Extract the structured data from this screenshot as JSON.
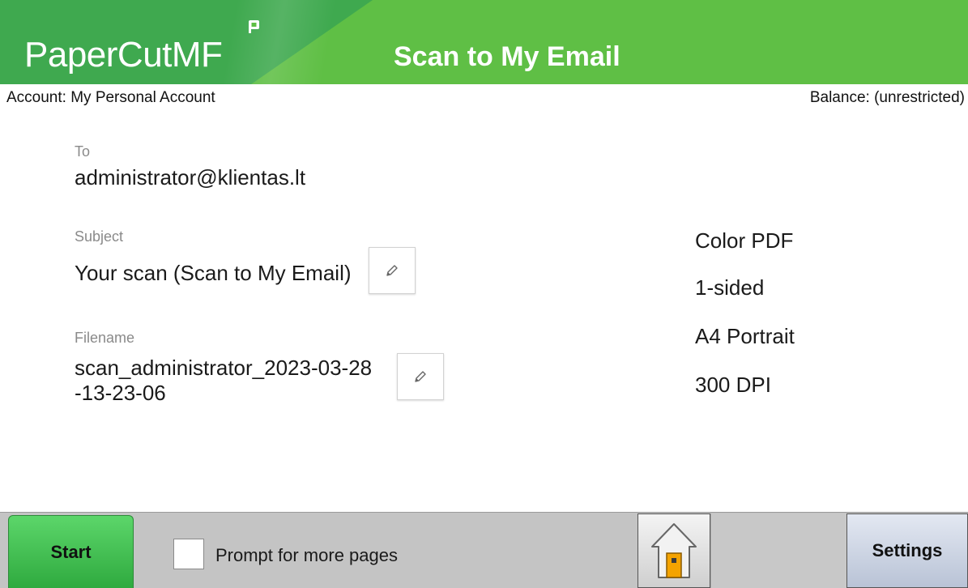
{
  "header": {
    "logo_main": "PaperCut",
    "logo_suffix": "MF",
    "title": "Scan to My Email"
  },
  "account_bar": {
    "account": "Account: My Personal Account",
    "balance": "Balance: (unrestricted)"
  },
  "form": {
    "to_label": "To",
    "to_value": "administrator@klientas.lt",
    "subject_label": "Subject",
    "subject_value": "Your scan (Scan to My Email)",
    "filename_label": "Filename",
    "filename_line1": "scan_administrator_2023-03-28",
    "filename_line2": "-13-23-06"
  },
  "options": {
    "format": "Color PDF",
    "sides": "1-sided",
    "paper": "A4 Portrait",
    "resolution": "300 DPI"
  },
  "bottom_bar": {
    "start_label": "Start",
    "prompt_label": "Prompt for more pages",
    "prompt_checked": false,
    "settings_label": "Settings"
  },
  "icons": {
    "edit": "pencil-icon",
    "home": "home-icon",
    "logo_flag": "papercut-flag-icon"
  },
  "colors": {
    "header_green": "#5fbf45",
    "start_green": "#2faa3f"
  }
}
